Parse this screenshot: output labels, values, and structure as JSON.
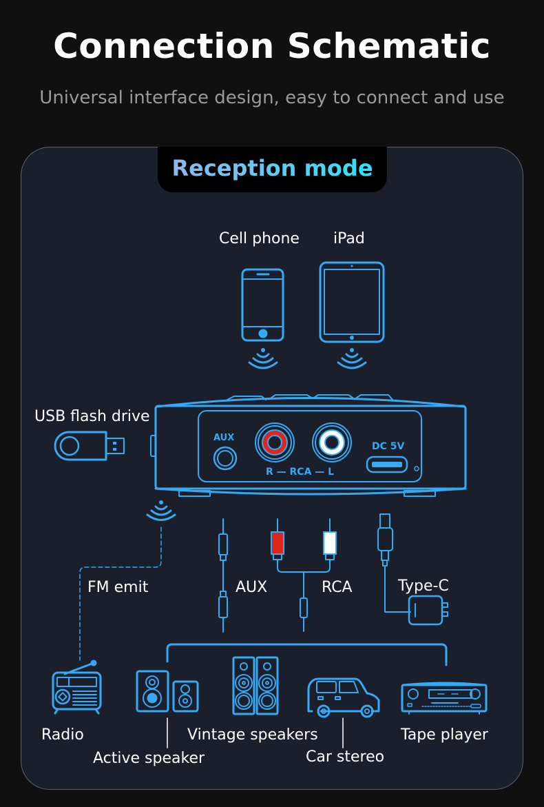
{
  "header": {
    "title": "Connection Schematic",
    "subtitle": "Universal interface design, easy to connect and use"
  },
  "panel": {
    "mode_label": "Reception mode",
    "accent_color": "#36a9f4",
    "sources": [
      {
        "label": "Cell phone",
        "icon": "phone-icon"
      },
      {
        "label": "iPad",
        "icon": "tablet-icon"
      }
    ],
    "usb_label": "USB flash drive",
    "device_ports": {
      "aux": "AUX",
      "rca": "R — RCA — L",
      "dc": "DC 5V",
      "rca_right_color": "#e0261b",
      "rca_left_color": "#ffffff"
    },
    "cables": {
      "fm": "FM emit",
      "aux": "AUX",
      "rca": "RCA",
      "typec": "Type-C"
    },
    "outputs": [
      {
        "label": "Radio",
        "icon": "radio-icon"
      },
      {
        "label": "Active speaker",
        "icon": "active-speaker-icon"
      },
      {
        "label": "Vintage speakers",
        "icon": "vintage-speakers-icon"
      },
      {
        "label": "Car stereo",
        "icon": "car-icon"
      },
      {
        "label": "Tape player",
        "icon": "tape-player-icon"
      }
    ]
  }
}
